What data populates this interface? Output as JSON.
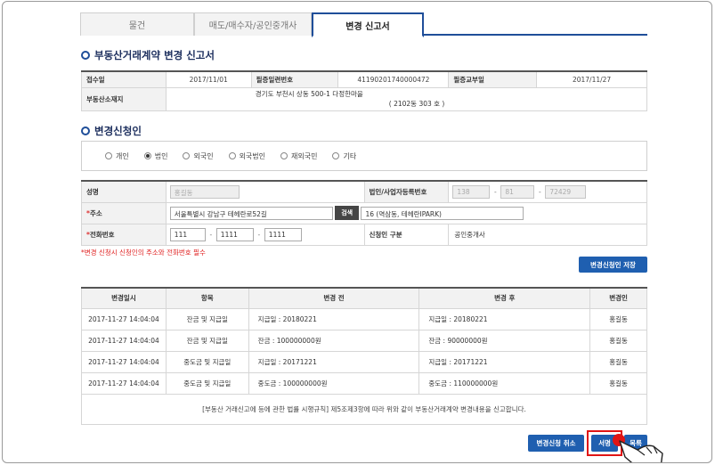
{
  "tabs": [
    {
      "label": "물건",
      "active": false
    },
    {
      "label": "매도/매수자/공인중개사",
      "active": false
    },
    {
      "label": "변경 신고서",
      "active": true
    }
  ],
  "report": {
    "title": "부동산거래계약 변경 신고서",
    "receipt_date_label": "접수일",
    "receipt_date": "2017/11/01",
    "cert_no_label": "필증일련번호",
    "cert_no": "41190201740000472",
    "issue_date_label": "필증교부일",
    "issue_date": "2017/11/27",
    "location_label": "부동산소재지",
    "address": "경기도 부천시 상동 500-1 다정한마을",
    "unit": "( 2102동 303 호 )"
  },
  "applicant": {
    "section_title": "변경신청인",
    "types": [
      {
        "label": "개인",
        "selected": false
      },
      {
        "label": "법인",
        "selected": true
      },
      {
        "label": "외국인",
        "selected": false
      },
      {
        "label": "외국법인",
        "selected": false
      },
      {
        "label": "재외국민",
        "selected": false
      },
      {
        "label": "기타",
        "selected": false
      }
    ],
    "name_label": "성명",
    "name_value": "홍길동",
    "biz_no_label": "법인/사업자등록번호",
    "biz_no_1": "138",
    "biz_no_2": "81",
    "biz_no_3": "72429",
    "address_label": "주소",
    "address_value": "서울특별시 강남구 테헤란로52길",
    "search_button": "검색",
    "address_detail": "16 (역삼동, 테헤란IPARK)",
    "phone_label": "전화번호",
    "phone_1": "111",
    "phone_2": "1111",
    "phone_3": "1111",
    "applicant_type_label": "신청인 구분",
    "applicant_type_value": "공인중개사",
    "notice": "*변경 신청시 신청인의 주소와 전화번호 필수",
    "save_button": "변경신청인 저장"
  },
  "history": {
    "headers": [
      "변경일시",
      "항목",
      "변경 전",
      "변경 후",
      "변경인"
    ],
    "rows": [
      [
        "2017-11-27 14:04:04",
        "잔금 및 지급일",
        "지급일 : 20180221",
        "지급일 : 20180221",
        "홍길동"
      ],
      [
        "2017-11-27 14:04:04",
        "잔금 및 지급일",
        "잔금 : 100000000원",
        "잔금 : 90000000원",
        "홍길동"
      ],
      [
        "2017-11-27 14:04:04",
        "중도금 및 지급일",
        "지급일 : 20171221",
        "지급일 : 20171221",
        "홍길동"
      ],
      [
        "2017-11-27 14:04:04",
        "중도금 및 지급일",
        "중도금 : 100000000원",
        "중도금 : 110000000원",
        "홍길동"
      ]
    ],
    "declaration": "[부동산 거래신고에 등에 관한 법률 시행규칙] 제5조제3항에 따라 위와 같이 부동산거래계약 변경내용을 신고합니다."
  },
  "footer": {
    "cancel_button": "변경신청 취소",
    "sign_button": "서명",
    "list_button": "목록"
  },
  "colors": {
    "accent": "#1f5fb0",
    "tab_border": "#1f4e99",
    "highlight": "#e01515"
  }
}
